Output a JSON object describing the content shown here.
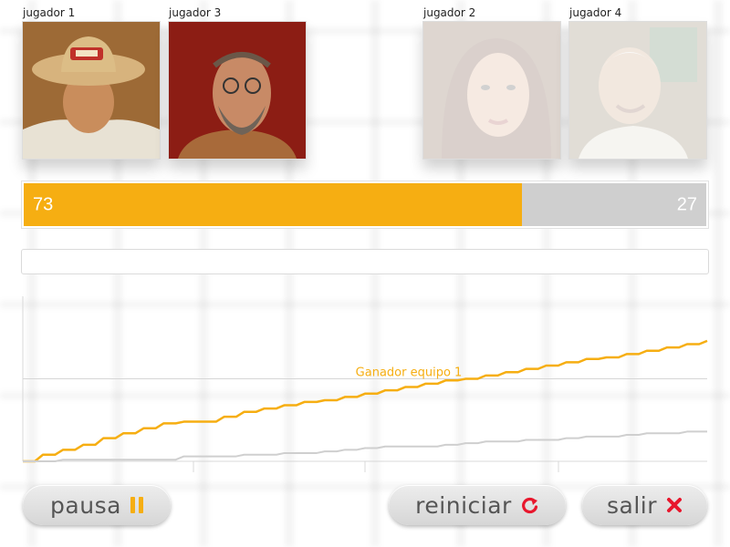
{
  "players": [
    {
      "label": "jugador 1",
      "active": true
    },
    {
      "label": "jugador 3",
      "active": true
    },
    {
      "label": "jugador 2",
      "active": false
    },
    {
      "label": "jugador 4",
      "active": false
    }
  ],
  "score": {
    "team1": 73,
    "team2": 27,
    "team1_color": "#f6ae12",
    "team2_color": "#cfcfcf"
  },
  "message": "",
  "chart_data": {
    "type": "line",
    "annotation": "Ganador equipo 1",
    "annotation_color": "#f6ae12",
    "series": [
      {
        "color": "#f6ae12",
        "values": [
          0,
          4,
          7,
          10,
          14,
          17,
          20,
          23,
          24,
          24,
          27,
          30,
          32,
          34,
          36,
          37,
          39,
          41,
          43,
          45,
          47,
          49,
          50,
          52,
          54,
          56,
          58,
          60,
          62,
          63,
          65,
          67,
          69,
          71,
          73
        ]
      },
      {
        "color": "#cfcfcf",
        "values": [
          0,
          0,
          1,
          1,
          1,
          1,
          1,
          1,
          3,
          3,
          3,
          4,
          4,
          5,
          5,
          6,
          7,
          8,
          9,
          9,
          9,
          10,
          11,
          12,
          12,
          13,
          13,
          14,
          15,
          15,
          16,
          17,
          17,
          18,
          18
        ]
      }
    ],
    "threshold": 50,
    "ylim": [
      0,
      100
    ],
    "grid": true
  },
  "controls": {
    "pause_label": "pausa",
    "pause_icon": "pause-icon",
    "restart_label": "reiniciar",
    "restart_icon": "restart-icon",
    "exit_label": "salir",
    "exit_icon": "close-icon",
    "pause_icon_color": "#f6ae12",
    "restart_icon_color": "#e8172d",
    "exit_icon_color": "#e8172d"
  }
}
